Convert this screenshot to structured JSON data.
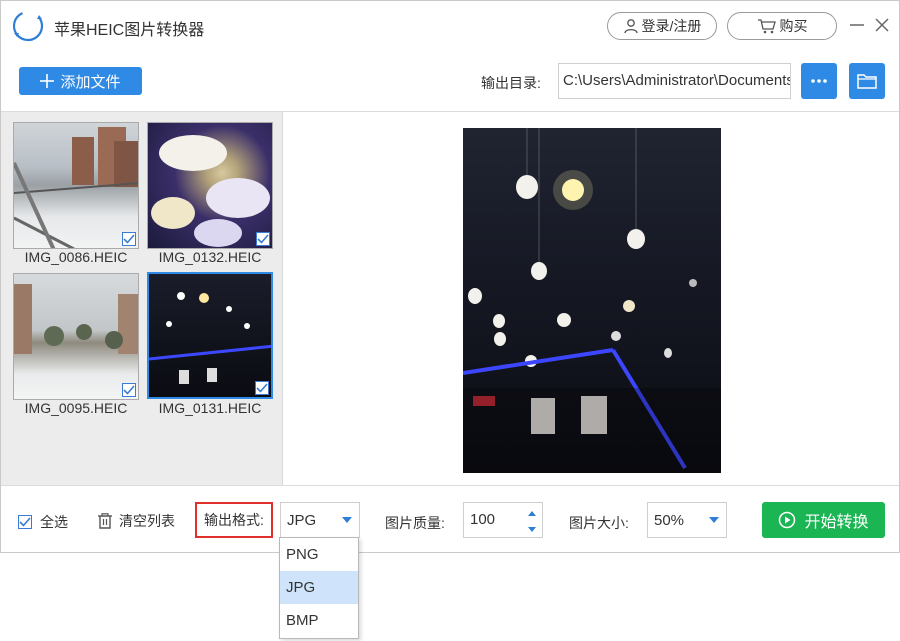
{
  "app": {
    "title": "苹果HEIC图片转换器",
    "logo_text": "HEIC",
    "login_label": "登录/注册",
    "buy_label": "购买"
  },
  "toolbar": {
    "add_file_label": "添加文件",
    "output_dir_label": "输出目录:",
    "output_dir_value": "C:\\Users\\Administrator\\Documents"
  },
  "thumbnails": [
    {
      "name": "IMG_0086.HEIC",
      "checked": true,
      "selected": false
    },
    {
      "name": "IMG_0132.HEIC",
      "checked": true,
      "selected": false
    },
    {
      "name": "IMG_0095.HEIC",
      "checked": true,
      "selected": false
    },
    {
      "name": "IMG_0131.HEIC",
      "checked": true,
      "selected": true
    }
  ],
  "bottom": {
    "select_all_label": "全选",
    "clear_list_label": "清空列表",
    "format_label": "输出格式:",
    "format_value": "JPG",
    "quality_label": "图片质量:",
    "quality_value": "100",
    "size_label": "图片大小:",
    "size_value": "50%",
    "start_label": "开始转换"
  },
  "format_dropdown": {
    "options": [
      "PNG",
      "JPG",
      "BMP"
    ],
    "selected": "JPG"
  },
  "colors": {
    "accent_blue": "#2f8ae6",
    "start_green": "#1cb554",
    "highlight_red": "#e0302b"
  }
}
